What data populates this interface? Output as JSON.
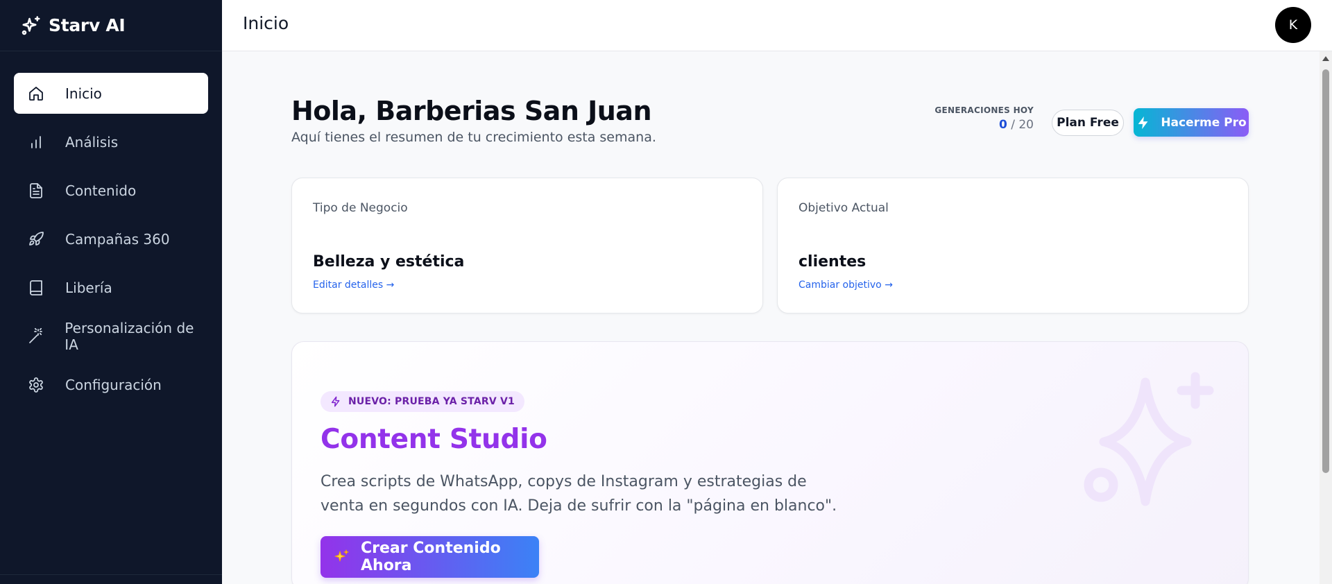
{
  "brand": {
    "name": "Starv AI"
  },
  "sidebar": {
    "items": [
      {
        "label": "Inicio",
        "icon": "home-icon",
        "active": true
      },
      {
        "label": "Análisis",
        "icon": "bar-chart-icon",
        "active": false
      },
      {
        "label": "Contenido",
        "icon": "document-icon",
        "active": false
      },
      {
        "label": "Campañas 360",
        "icon": "rocket-icon",
        "active": false
      },
      {
        "label": "Libería",
        "icon": "book-icon",
        "active": false
      },
      {
        "label": "Personalización de IA",
        "icon": "magic-wand-icon",
        "active": false
      },
      {
        "label": "Configuración",
        "icon": "gear-icon",
        "active": false
      }
    ]
  },
  "header": {
    "title": "Inicio",
    "avatar_initial": "K"
  },
  "main": {
    "greeting": "Hola, Barberias San Juan",
    "subtitle": "Aquí tienes el resumen de tu crecimiento esta semana.",
    "generations": {
      "label": "GENERACIONES HOY",
      "used": "0",
      "limit": "/ 20"
    },
    "plan_badge": "Plan Free",
    "pro_button": "Hacerme Pro",
    "cards": [
      {
        "label": "Tipo de Negocio",
        "value": "Belleza y estética",
        "link": "Editar detalles →"
      },
      {
        "label": "Objetivo Actual",
        "value": "clientes",
        "link": "Cambiar objetivo →"
      }
    ],
    "studio": {
      "badge": "NUEVO: PRUEBA YA STARV V1",
      "title": "Content Studio",
      "description": "Crea scripts de WhatsApp, copys de Instagram y estrategias de venta en segundos con IA. Deja de sufrir con la \"página en blanco\".",
      "cta": "Crear Contenido Ahora"
    }
  },
  "colors": {
    "sidebar_bg": "#0f172a",
    "accent_blue": "#2563eb",
    "accent_purple": "#9333ea",
    "pro_gradient_start": "#06b6d4",
    "pro_gradient_end": "#8b5cf6"
  }
}
